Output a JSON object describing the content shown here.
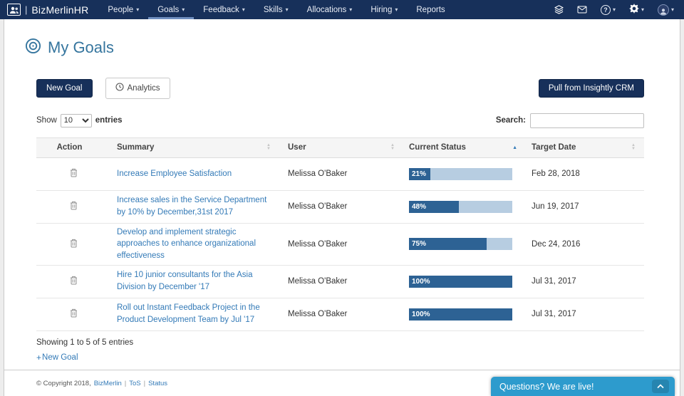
{
  "navbar": {
    "brand": "BizMerlinHR",
    "brand_sep": "|",
    "items": [
      {
        "label": "People",
        "caret": true
      },
      {
        "label": "Goals",
        "caret": true,
        "active": true
      },
      {
        "label": "Feedback",
        "caret": true
      },
      {
        "label": "Skills",
        "caret": true
      },
      {
        "label": "Allocations",
        "caret": true
      },
      {
        "label": "Hiring",
        "caret": true
      },
      {
        "label": "Reports",
        "caret": false
      }
    ],
    "help_glyph": "?"
  },
  "page": {
    "title": "My Goals"
  },
  "toolbar": {
    "new_goal": "New Goal",
    "analytics": "Analytics",
    "pull_crm": "Pull from Insightly CRM"
  },
  "table_controls": {
    "show_label": "Show",
    "page_size": "10",
    "entries_label": "entries",
    "search_label": "Search:",
    "search_value": ""
  },
  "table": {
    "headers": [
      "Action",
      "Summary",
      "User",
      "Current Status",
      "Target Date"
    ],
    "sorted_column": "Current Status",
    "sort_direction": "asc",
    "rows": [
      {
        "summary": "Increase Employee Satisfaction",
        "user": "Melissa O'Baker",
        "progress": 21,
        "progress_label": "21%",
        "date": "Feb 28, 2018"
      },
      {
        "summary": "Increase sales in the Service Department by 10% by December,31st 2017",
        "user": "Melissa O'Baker",
        "progress": 48,
        "progress_label": "48%",
        "date": "Jun 19, 2017"
      },
      {
        "summary": "Develop and implement strategic approaches to enhance organizational effectiveness",
        "user": "Melissa O'Baker",
        "progress": 75,
        "progress_label": "75%",
        "date": "Dec 24, 2016"
      },
      {
        "summary": "Hire 10 junior consultants for the Asia Division by December '17",
        "user": "Melissa O'Baker",
        "progress": 100,
        "progress_label": "100%",
        "date": "Jul 31, 2017"
      },
      {
        "summary": "Roll out Instant Feedback Project in the Product Development Team by Jul '17",
        "user": "Melissa O'Baker",
        "progress": 100,
        "progress_label": "100%",
        "date": "Jul 31, 2017"
      }
    ]
  },
  "table_footer": {
    "showing": "Showing 1 to 5 of 5 entries",
    "plus_glyph": "+",
    "new_goal_link": "New Goal"
  },
  "footer": {
    "copyright": "© Copyright 2018,",
    "brand_link": "BizMerlin",
    "sep": "|",
    "tos": "ToS",
    "status": "Status"
  },
  "chat": {
    "label": "Questions? We are live!"
  },
  "colors": {
    "navbar_bg": "#17305a",
    "accent_link": "#337ab7",
    "progress_fill": "#2d6294",
    "progress_track": "#b7cde1",
    "chat_bg": "#2d9bcd"
  }
}
